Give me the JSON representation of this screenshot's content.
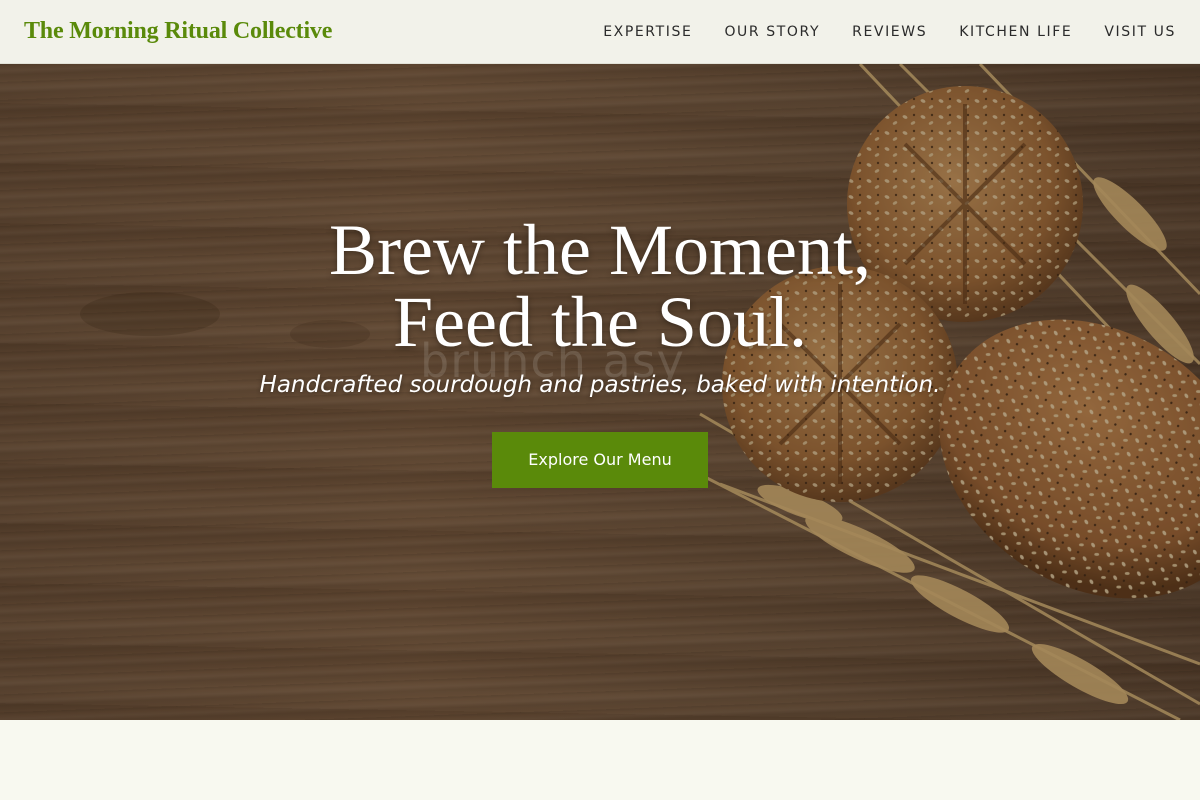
{
  "header": {
    "brand": "The Morning Ritual Collective",
    "nav": [
      {
        "label": "EXPERTISE"
      },
      {
        "label": "OUR STORY"
      },
      {
        "label": "REVIEWS"
      },
      {
        "label": "KITCHEN LIFE"
      },
      {
        "label": "VISIT US"
      }
    ]
  },
  "hero": {
    "title_line1": "Brew the Moment,",
    "title_line2": "Feed the Soul.",
    "subtitle": "Handcrafted sourdough and pastries, baked with intention.",
    "cta_label": "Explore Our Menu",
    "watermark_text": "brunch asy"
  },
  "colors": {
    "accent": "#5a8a0a",
    "nav_background": "#f2f2ea",
    "page_background": "#f8f9f0",
    "hero_wood": "#6d513b"
  }
}
